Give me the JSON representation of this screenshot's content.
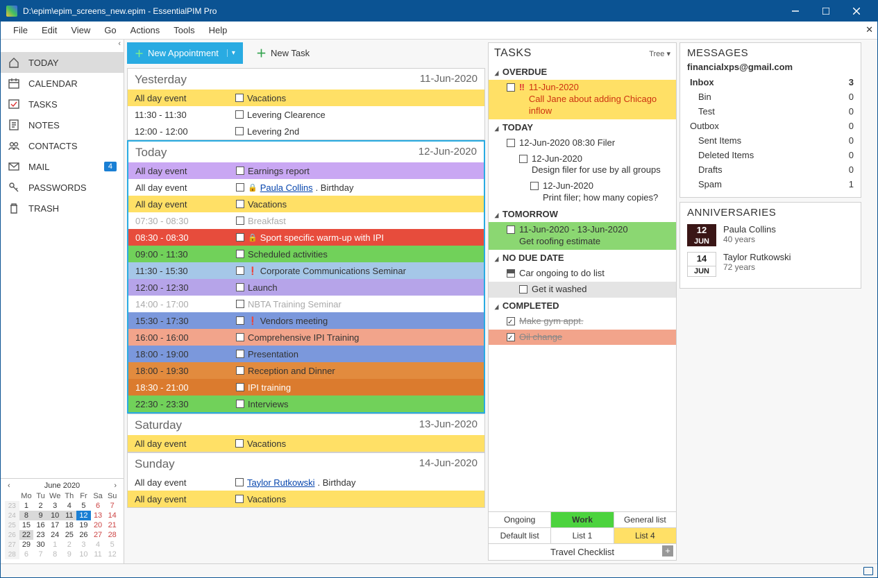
{
  "window": {
    "title": "D:\\epim\\epim_screens_new.epim - EssentialPIM Pro"
  },
  "menu": [
    "File",
    "Edit",
    "View",
    "Go",
    "Actions",
    "Tools",
    "Help"
  ],
  "nav": [
    {
      "label": "TODAY",
      "icon": "home",
      "active": true
    },
    {
      "label": "CALENDAR",
      "icon": "calendar"
    },
    {
      "label": "TASKS",
      "icon": "check"
    },
    {
      "label": "NOTES",
      "icon": "note"
    },
    {
      "label": "CONTACTS",
      "icon": "contacts"
    },
    {
      "label": "MAIL",
      "icon": "mail",
      "badge": "4"
    },
    {
      "label": "PASSWORDS",
      "icon": "key"
    },
    {
      "label": "TRASH",
      "icon": "trash"
    }
  ],
  "toolbar": {
    "new_appt": "New Appointment",
    "new_task": "New Task"
  },
  "minical": {
    "title": "June  2020",
    "dow": [
      "Mo",
      "Tu",
      "We",
      "Th",
      "Fr",
      "Sa",
      "Su"
    ],
    "weeks": [
      {
        "wk": "23",
        "days": [
          {
            "n": 1
          },
          {
            "n": 2
          },
          {
            "n": 3
          },
          {
            "n": 4
          },
          {
            "n": 5
          },
          {
            "n": 6,
            "o": 1
          },
          {
            "n": 7,
            "o": 1
          }
        ]
      },
      {
        "wk": "24",
        "days": [
          {
            "n": 8,
            "s": 1
          },
          {
            "n": 9,
            "s": 1
          },
          {
            "n": 10,
            "s": 1
          },
          {
            "n": 11,
            "s": 1
          },
          {
            "n": 12,
            "t": 1
          },
          {
            "n": 13,
            "o": 1
          },
          {
            "n": 14,
            "o": 1
          }
        ]
      },
      {
        "wk": "25",
        "days": [
          {
            "n": 15
          },
          {
            "n": 16
          },
          {
            "n": 17
          },
          {
            "n": 18
          },
          {
            "n": 19
          },
          {
            "n": 20,
            "o": 1
          },
          {
            "n": 21,
            "o": 1
          }
        ]
      },
      {
        "wk": "26",
        "days": [
          {
            "n": 22,
            "s": 1
          },
          {
            "n": 23
          },
          {
            "n": 24
          },
          {
            "n": 25
          },
          {
            "n": 26
          },
          {
            "n": 27,
            "o": 1
          },
          {
            "n": 28,
            "o": 1
          }
        ]
      },
      {
        "wk": "27",
        "days": [
          {
            "n": 29
          },
          {
            "n": 30
          },
          {
            "n": 1,
            "d": 1
          },
          {
            "n": 2,
            "d": 1
          },
          {
            "n": 3,
            "d": 1
          },
          {
            "n": 4,
            "d": 1
          },
          {
            "n": 5,
            "d": 1
          }
        ]
      },
      {
        "wk": "28",
        "days": [
          {
            "n": 6,
            "d": 1
          },
          {
            "n": 7,
            "d": 1
          },
          {
            "n": 8,
            "d": 1
          },
          {
            "n": 9,
            "d": 1
          },
          {
            "n": 10,
            "d": 1
          },
          {
            "n": 11,
            "d": 1
          },
          {
            "n": 12,
            "d": 1
          }
        ]
      }
    ]
  },
  "days": [
    {
      "name": "Yesterday",
      "date": "11-Jun-2020",
      "today": false,
      "events": [
        {
          "time": "All day event",
          "label": "Vacations",
          "cls": "c-yellow"
        },
        {
          "time": "11:30 - 11:30",
          "label": "Levering Clearence",
          "cls": "c-none"
        },
        {
          "time": "12:00 - 12:00",
          "label": "Levering 2nd",
          "cls": "c-none"
        }
      ]
    },
    {
      "name": "Today",
      "date": "12-Jun-2020",
      "today": true,
      "events": [
        {
          "time": "All day event",
          "label": "Earnings report",
          "cls": "c-purple"
        },
        {
          "time": "All day event",
          "link": "Paula Collins",
          "after": ". Birthday",
          "cls": "c-none",
          "lock": true
        },
        {
          "time": "All day event",
          "label": "Vacations",
          "cls": "c-yellow"
        },
        {
          "time": "07:30 - 08:30",
          "label": "Breakfast",
          "cls": "c-gray"
        },
        {
          "time": "08:30 - 08:30",
          "label": "Sport specific warm-up with IPI",
          "cls": "c-red",
          "lock": true
        },
        {
          "time": "09:00 - 11:30",
          "label": "Scheduled activities",
          "cls": "c-green"
        },
        {
          "time": "11:30 - 15:30",
          "label": "Corporate Communications Seminar",
          "cls": "c-lblue",
          "bang": true
        },
        {
          "time": "12:00 - 12:30",
          "label": "Launch",
          "cls": "c-violet"
        },
        {
          "time": "14:00 - 17:00",
          "label": "NBTA Training Seminar",
          "cls": "c-gray"
        },
        {
          "time": "15:30 - 17:30",
          "label": "Vendors meeting",
          "cls": "c-blue",
          "bang": true,
          "now": true
        },
        {
          "time": "16:00 - 16:00",
          "label": "Comprehensive IPI Training",
          "cls": "c-salmon"
        },
        {
          "time": "18:00 - 19:00",
          "label": "Presentation",
          "cls": "c-blue"
        },
        {
          "time": "18:00 - 19:30",
          "label": "Reception and Dinner",
          "cls": "c-orange"
        },
        {
          "time": "18:30 - 21:00",
          "label": "IPI training",
          "cls": "c-dorange"
        },
        {
          "time": "22:30 - 23:30",
          "label": "Interviews",
          "cls": "c-green"
        }
      ]
    },
    {
      "name": "Saturday",
      "date": "13-Jun-2020",
      "today": false,
      "events": [
        {
          "time": "All day event",
          "label": "Vacations",
          "cls": "c-yellow"
        }
      ]
    },
    {
      "name": "Sunday",
      "date": "14-Jun-2020",
      "today": false,
      "events": [
        {
          "time": "All day event",
          "link": "Taylor Rutkowski",
          "after": ". Birthday",
          "cls": "c-none"
        },
        {
          "time": "All day event",
          "label": "Vacations",
          "cls": "c-yellow"
        }
      ]
    }
  ],
  "tasks": {
    "title": "TASKS",
    "tree": "Tree",
    "tabs1": [
      "Ongoing",
      "Work",
      "General list"
    ],
    "tabs1_active": 1,
    "tabs2": [
      "Default list",
      "List 1",
      "List 4"
    ],
    "tabs2_active": 2,
    "travel": "Travel Checklist",
    "groups": [
      {
        "name": "OVERDUE",
        "rows": [
          {
            "cls": "overdue",
            "bang": "‼",
            "date": "11-Jun-2020",
            "text": "Call Jane about adding Chicago inflow"
          }
        ]
      },
      {
        "name": "TODAY",
        "rows": [
          {
            "text": "12-Jun-2020 08:30 Filer"
          },
          {
            "sub": 1,
            "date": "12-Jun-2020",
            "text": "Design filer for use by all groups"
          },
          {
            "sub": 2,
            "date": "12-Jun-2020",
            "text": "Print filer; how many copies?"
          }
        ]
      },
      {
        "name": "TOMORROW",
        "rows": [
          {
            "cls": "tsk-green",
            "date": "11-Jun-2020 - 13-Jun-2020",
            "text": "Get roofing estimate"
          }
        ]
      },
      {
        "name": "NO DUE DATE",
        "rows": [
          {
            "half": true,
            "text": "Car ongoing to do list"
          },
          {
            "sub": 1,
            "cls": "tsk-gray",
            "text": "Get it washed"
          }
        ]
      },
      {
        "name": "COMPLETED",
        "rows": [
          {
            "done": true,
            "text": "Make gym appt."
          },
          {
            "done": true,
            "cls": "tsk-salmon",
            "text": "Oil change"
          }
        ]
      }
    ]
  },
  "messages": {
    "title": "MESSAGES",
    "account": "financialxps@gmail.com",
    "folders": [
      {
        "name": "Inbox",
        "count": "3",
        "bold": true
      },
      {
        "name": "Bin",
        "count": "0",
        "sub": true
      },
      {
        "name": "Test",
        "count": "0",
        "sub": true
      },
      {
        "name": "Outbox",
        "count": "0"
      },
      {
        "name": "Sent Items",
        "count": "0",
        "sub": true
      },
      {
        "name": "Deleted Items",
        "count": "0",
        "sub": true
      },
      {
        "name": "Drafts",
        "count": "0",
        "sub": true
      },
      {
        "name": "Spam",
        "count": "1",
        "sub": true
      }
    ]
  },
  "anniv": {
    "title": "ANNIVERSARIES",
    "items": [
      {
        "day": "12",
        "mon": "JUN",
        "name": "Paula Collins",
        "age": "40 years",
        "alt": false
      },
      {
        "day": "14",
        "mon": "JUN",
        "name": "Taylor Rutkowski",
        "age": "72 years",
        "alt": true
      }
    ]
  }
}
